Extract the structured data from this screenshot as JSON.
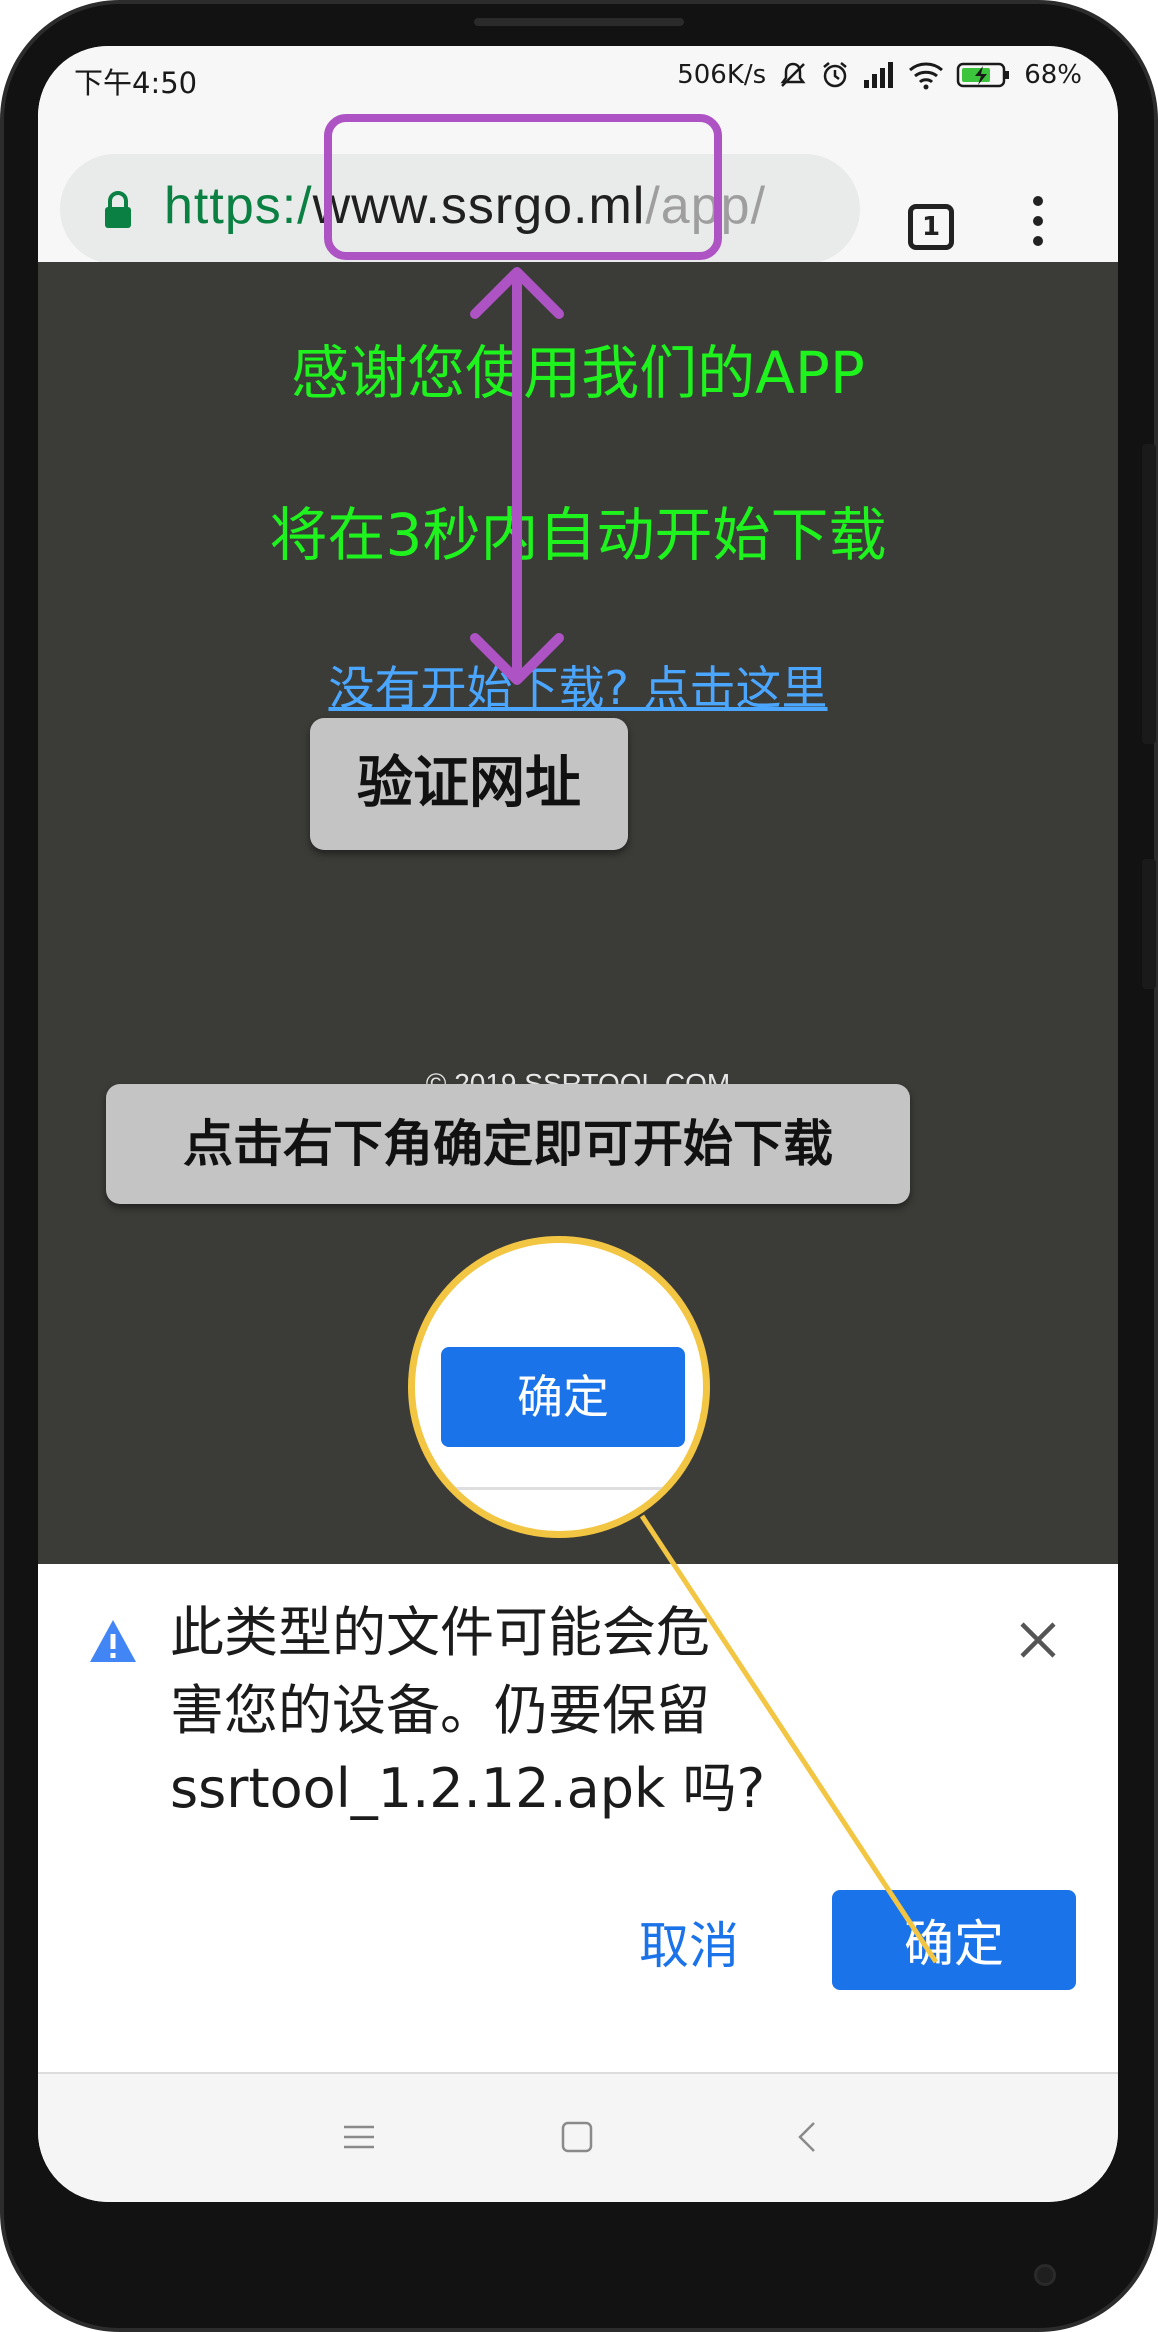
{
  "status_bar": {
    "time": "下午4:50",
    "network_speed": "506K/s",
    "battery_percent": "68%",
    "icons": [
      "mute-icon",
      "alarm-icon",
      "signal-icon",
      "wifi-icon",
      "battery-icon"
    ]
  },
  "browser": {
    "url_scheme": "https:/",
    "url_host": "www.ssrgo.ml",
    "url_rest": "/app/",
    "tab_count": "1"
  },
  "page": {
    "line1": "感谢您使用我们的APP",
    "line2": "将在3秒内自动开始下载",
    "download_link": "没有开始下载? 点击这里",
    "copyright": "© 2019 SSRTOOL.COM"
  },
  "annotations": {
    "verify_label": "验证网址",
    "tap_instruction": "点击右下角确定即可开始下载",
    "zoom_button": "确定",
    "colors": {
      "highlight": "#ad53c4",
      "pointer": "#f2c543",
      "note_bg": "#c4c4c4"
    }
  },
  "dialog": {
    "message_line1": "此类型的文件可能会危",
    "message_line2": "害您的设备。仍要保留",
    "message_line3": "ssrtool_1.2.12.apk 吗?",
    "cancel_label": "取消",
    "ok_label": "确定",
    "accent_color": "#1a73e8"
  },
  "nav_bar": {
    "icons": [
      "menu-icon",
      "home-icon",
      "back-icon"
    ]
  }
}
